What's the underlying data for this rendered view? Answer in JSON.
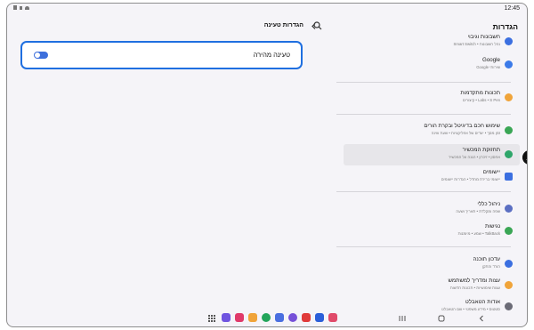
{
  "status": {
    "time": "12:45"
  },
  "settings": {
    "title": "הגדרות",
    "items": [
      {
        "title": "חשבונות וגיבוי",
        "sub": "נהל חשבונות • Smart Switch",
        "color": "#3b6fe0"
      },
      {
        "title": "Google",
        "sub": "שירותי Google",
        "color": "#3b7ae8"
      },
      {
        "title": "תכונות מתקדמות",
        "sub": "Labs • S Pen • קיצורים",
        "color": "#f0a43a"
      },
      {
        "title": "שימוש חכם בדיגיטל ובקרת הורים",
        "sub": "זמן מסך • יעדים של אפליקציות • שעת שינה",
        "color": "#3aa655"
      },
      {
        "title": "תחזוקת המכשיר",
        "sub": "אחסון • זיכרון • הגנה על המכשיר",
        "color": "#2fa66a"
      },
      {
        "title": "יישומים",
        "sub": "יישומי ברירת מחדל • הגדרות יישומים",
        "color": "#3b6fe0"
      },
      {
        "title": "ניהול כללי",
        "sub": "שפה ומקלדת • תאריך ושעה",
        "color": "#5b6fc2"
      },
      {
        "title": "נגישות",
        "sub": "TalkBack • שמע • מיומנות",
        "color": "#3aa655"
      },
      {
        "title": "עדכון תוכנה",
        "sub": "הורד והתקן",
        "color": "#3b6fe0"
      },
      {
        "title": "עצות ומדריך למשתמש",
        "sub": "עצות שימושיות • תכונות חדשות",
        "color": "#f0a43a"
      },
      {
        "title": "אודות הטאבלט",
        "sub": "סטטוס • מידע משפטי • שם הטאבלט",
        "color": "#6b6b76"
      }
    ]
  },
  "detail": {
    "title": "הגדרות טעינה",
    "fast_charging_label": "טעינה מהירה",
    "fast_charging_enabled": true
  },
  "taskbar": {
    "apps": [
      {
        "name": "messages-app",
        "color": "#6f54e0"
      },
      {
        "name": "camera-app",
        "color": "#e03a6a"
      },
      {
        "name": "notes-app",
        "color": "#f0a43a"
      },
      {
        "name": "phone-app",
        "color": "#22a45a"
      },
      {
        "name": "contacts-app",
        "color": "#4a6fe0"
      },
      {
        "name": "internet-app",
        "color": "#7650d8"
      },
      {
        "name": "gallery-app",
        "color": "#e03a3a"
      },
      {
        "name": "store-app",
        "color": "#2b5fd9"
      },
      {
        "name": "flower-app",
        "color": "#e04a6a"
      }
    ]
  },
  "accent": "#1f6fe0"
}
